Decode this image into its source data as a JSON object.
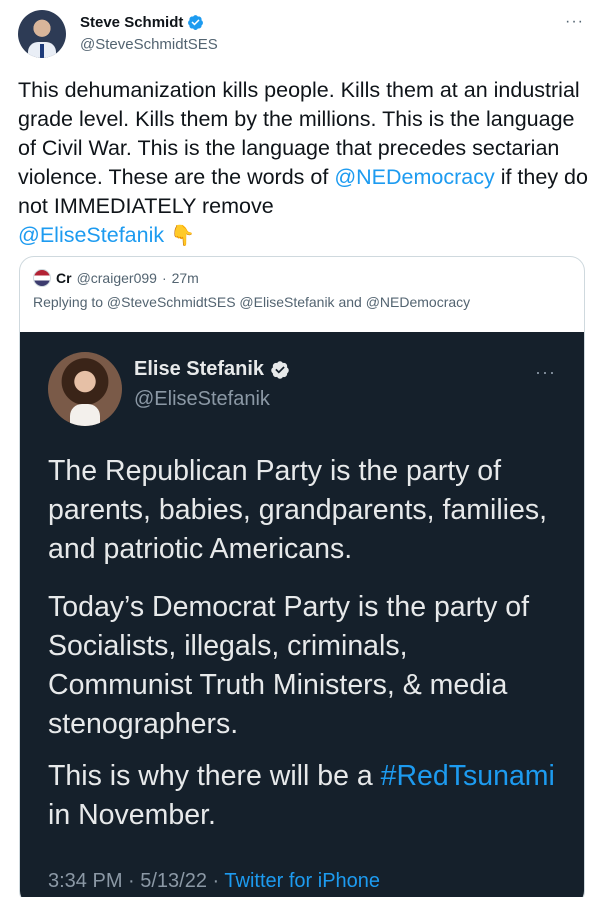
{
  "author": {
    "display_name": "Steve Schmidt",
    "handle": "@SteveSchmidtSES",
    "more_label": "···"
  },
  "tweet": {
    "text_before": "This dehumanization kills people. Kills them at an industrial grade level. Kills them by the millions. This is the language of Civil War. This is the language that precedes sectarian violence. These are the words of ",
    "mention1": "@NEDemocracy",
    "text_middle": " if they do not IMMEDIATELY remove ",
    "mention2": "@EliseStefanik",
    "emoji": "👇"
  },
  "quote": {
    "display_name": "Cr",
    "handle": "@craiger099",
    "separator": "·",
    "time": "27m",
    "reply_line": "Replying to @SteveSchmidtSES @EliseStefanik and @NEDemocracy"
  },
  "embedded": {
    "display_name": "Elise Stefanik",
    "handle": "@EliseStefanik",
    "more_label": "···",
    "para1": "The Republican Party is the party of parents, babies, grandparents, families, and patriotic Americans.",
    "para2": "Today’s Democrat Party is the party of Socialists, illegals, criminals, Communist Truth Ministers, & media stenographers.",
    "para3_before": "This is why there will be a ",
    "hashtag": "#RedTsunami",
    "para3_after": " in November.",
    "meta_time": "3:34 PM · 5/13/22 · ",
    "meta_source": "Twitter for iPhone"
  },
  "colors": {
    "link": "#1d9bf0",
    "text": "#0f1419",
    "secondary": "#536471",
    "dark_bg": "#15202b",
    "dark_text": "#e7e9ea"
  }
}
